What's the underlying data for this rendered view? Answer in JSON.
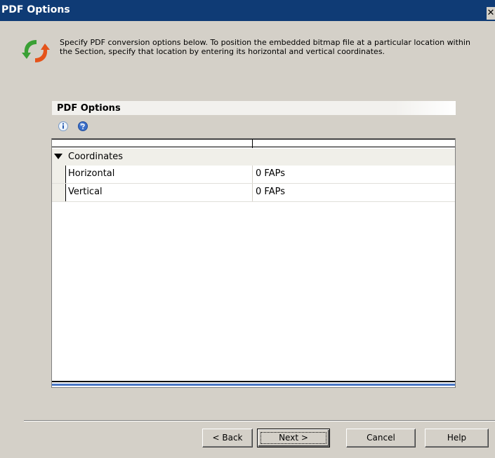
{
  "window": {
    "title": "PDF Options",
    "close_glyph": "✕"
  },
  "header": {
    "icon": "refresh-arrows-icon",
    "description": "Specify PDF conversion options below.  To position the embedded bitmap file at a particular location within the Section, specify that location by entering its horizontal and vertical coordinates."
  },
  "panel": {
    "title": "PDF Options",
    "toolbar": [
      {
        "icon": "info-icon"
      },
      {
        "icon": "help-icon"
      }
    ],
    "grid": {
      "category": {
        "label": "Coordinates",
        "expanded": true
      },
      "properties": [
        {
          "name": "Horizontal",
          "value": "0 FAPs"
        },
        {
          "name": "Vertical",
          "value": "0 FAPs"
        }
      ]
    }
  },
  "buttons": {
    "back": "< Back",
    "next": "Next >",
    "cancel": "Cancel",
    "help": "Help"
  },
  "colors": {
    "titlebar": "#0f3b75",
    "dialog_bg": "#d4d0c8",
    "grid_accent": "#4a77c6",
    "icon_green": "#3aa035",
    "icon_orange": "#e5531a"
  }
}
